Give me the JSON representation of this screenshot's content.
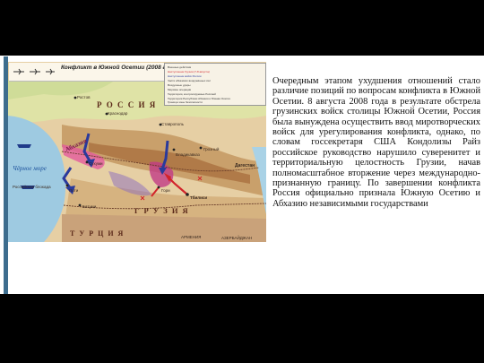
{
  "map": {
    "title": "Конфликт в Южной Осетии (2008 г.)",
    "labels": {
      "russia": "Р О С С И Я",
      "georgia": "Г Р У З И Я",
      "turkey": "Т У Р Ц И Я",
      "abkhazia": "Абхазия",
      "black_sea": "Чёрное море",
      "dagestan": "Дагестан",
      "armenia": "АРМЕНИЯ",
      "azerbaijan": "АЗЕРБАЙДЖАН",
      "russian_fleet": "Российская блокада",
      "rostov": "Ростов",
      "krasnodar": "Краснодар",
      "stavropol": "Ставрополь",
      "sukhumi": "Сухуми",
      "batumi": "Батуми",
      "tbilisi": "Тбилиси",
      "gori": "Гори",
      "poti": "Поти",
      "grozny": "Грозный",
      "vladikavkaz": "Владикавказ"
    },
    "legend_items": [
      "Военные действия",
      "Наступление Грузии (7-8 августа)",
      "Наступление войск России",
      "Части абхазских вооружённых сил",
      "Воздушные удары",
      "Морские операции",
      "Территории, контролируемые Россией",
      "Территория Республики Абхазия и Южная Осетия",
      "Граница зоны безопасности"
    ],
    "colors": {
      "georgia_attack": "#d2232a",
      "russia_attack": "#2a3a9c",
      "sea": "#9ecae1",
      "abkhazia": "#e45a9c",
      "south_ossetia": "#c23b86"
    }
  },
  "body_text": "Очередным этапом ухудшения отношений стало различие позиций по вопросам конфликта в Южной Осетии. 8 августа 2008 года в результате обстрела грузинских войск столицы Южной Осетии, Россия была вынуждена осуществить ввод миротворческих войск для урегулирования конфликта, однако, по словам госсекретаря США Кондолизы Райз российское руководство нарушило суверенитет и территориальную целостность Грузии, начав полномасштабное вторжение через международно-признанную границу. По завершении конфликта Россия официально признала Южную Осетию и Абхазию независимыми государствами"
}
